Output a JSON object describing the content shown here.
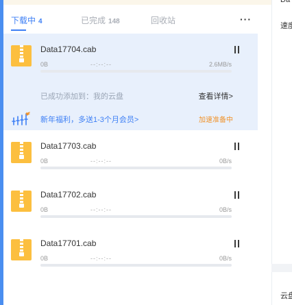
{
  "tabs": [
    {
      "label": "下载中",
      "count": "4",
      "active": true
    },
    {
      "label": "已完成",
      "count": "148",
      "active": false
    },
    {
      "label": "回收站",
      "count": "",
      "active": false
    }
  ],
  "more_icon": "more-horizontal-icon",
  "accent_color": "#3d7ff5",
  "warning_color": "#f0932b",
  "downloads": [
    {
      "name": "Data17704.cab",
      "size": "0B",
      "eta": "--:--:--",
      "speed": "2.6MB/s",
      "progress": 0,
      "selected": true
    },
    {
      "name": "Data17703.cab",
      "size": "0B",
      "eta": "--:--:--",
      "speed": "0B/s",
      "progress": 0,
      "selected": false
    },
    {
      "name": "Data17702.cab",
      "size": "0B",
      "eta": "--:--:--",
      "speed": "0B/s",
      "progress": 0,
      "selected": false
    },
    {
      "name": "Data17701.cab",
      "size": "0B",
      "eta": "--:--:--",
      "speed": "0B/s",
      "progress": 0,
      "selected": false
    }
  ],
  "detail": {
    "added_text": "已成功添加到：我的云盘",
    "view_link": "查看详情>"
  },
  "promo": {
    "text": "新年福利，多送1-3个月会员>",
    "status": "加速准备中"
  },
  "right_panel": {
    "top_text": "Da",
    "speed_label": "速度",
    "bottom_label": "云盘"
  }
}
